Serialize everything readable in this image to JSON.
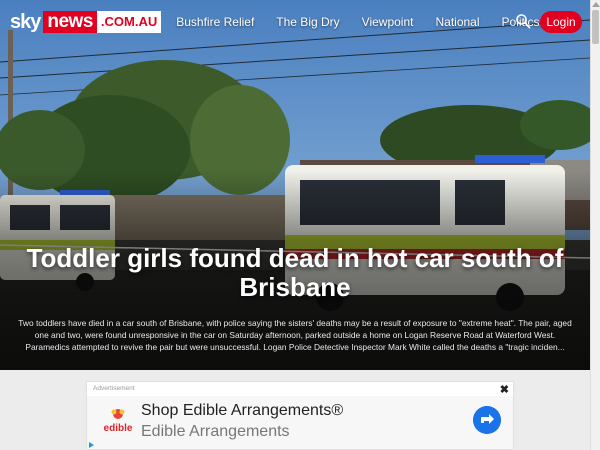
{
  "site": {
    "logo_sky": "sky",
    "logo_news": "news",
    "logo_domain": ".COM.AU",
    "brand_color": "#e1001f"
  },
  "nav": {
    "items": [
      {
        "label": "Bushfire Relief"
      },
      {
        "label": "The Big Dry"
      },
      {
        "label": "Viewpoint"
      },
      {
        "label": "National"
      },
      {
        "label": "PoliticsExtra"
      }
    ]
  },
  "header": {
    "search_icon": "search-icon",
    "login_label": "Login"
  },
  "article": {
    "headline": "Toddler girls found dead in hot car south of Brisbane",
    "summary": "Two toddlers have died in a car south of Brisbane, with police saying the sisters' deaths may be a result of exposure to \"extreme heat\". The pair, aged one and two, were found unresponsive in the car on Saturday afternoon, parked outside a home on Logan Reserve Road at Waterford West. Paramedics attempted to revive the pair but were unsuccessful. Logan Police Detective Inspector Mark White called the deaths a \"tragic inciden..."
  },
  "ad": {
    "label": "Advertisement",
    "close": "✖",
    "logo_text": "edible",
    "title": "Shop Edible Arrangements®",
    "subtitle": "Edible Arrangements",
    "arrow_icon": "directions-arrow-icon"
  }
}
